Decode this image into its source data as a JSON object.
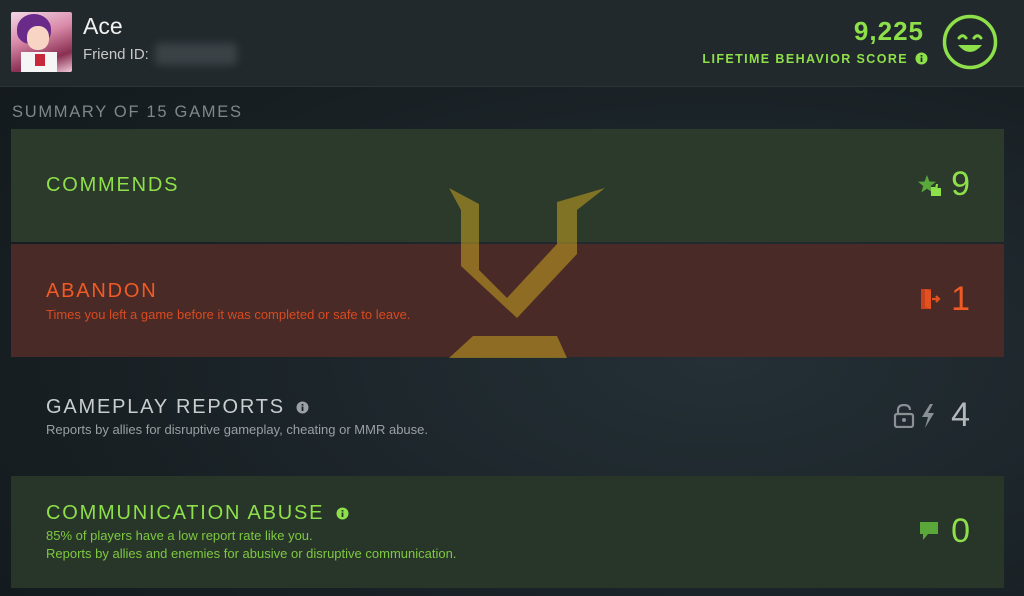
{
  "header": {
    "player_name": "Ace",
    "friend_id_label": "Friend ID:",
    "score_value": "9,225",
    "score_label": "LIFETIME BEHAVIOR SCORE"
  },
  "summary": {
    "title": "SUMMARY OF 15 GAMES"
  },
  "rows": {
    "commends": {
      "title": "COMMENDS",
      "value": "9"
    },
    "abandon": {
      "title": "ABANDON",
      "description": "Times you left a game before it was completed or safe to leave.",
      "value": "1"
    },
    "reports": {
      "title": "GAMEPLAY REPORTS",
      "description": "Reports by allies for disruptive gameplay, cheating or MMR abuse.",
      "value": "4"
    },
    "communication": {
      "title": "COMMUNICATION ABUSE",
      "description_line1": "85% of players have a low report rate like you.",
      "description_line2": "Reports by allies and enemies for abusive or disruptive communication.",
      "value": "0"
    }
  },
  "icons": {
    "score_status": "smiley-face-icon",
    "commends": "star-thumb-icon",
    "abandon": "exit-door-icon",
    "reports": "lock-lightning-icon",
    "communication": "chat-bubble-icon",
    "info": "info-icon"
  },
  "colors": {
    "positive": "#8ee04a",
    "negative": "#f05a24",
    "neutral": "#c9cdcf"
  }
}
